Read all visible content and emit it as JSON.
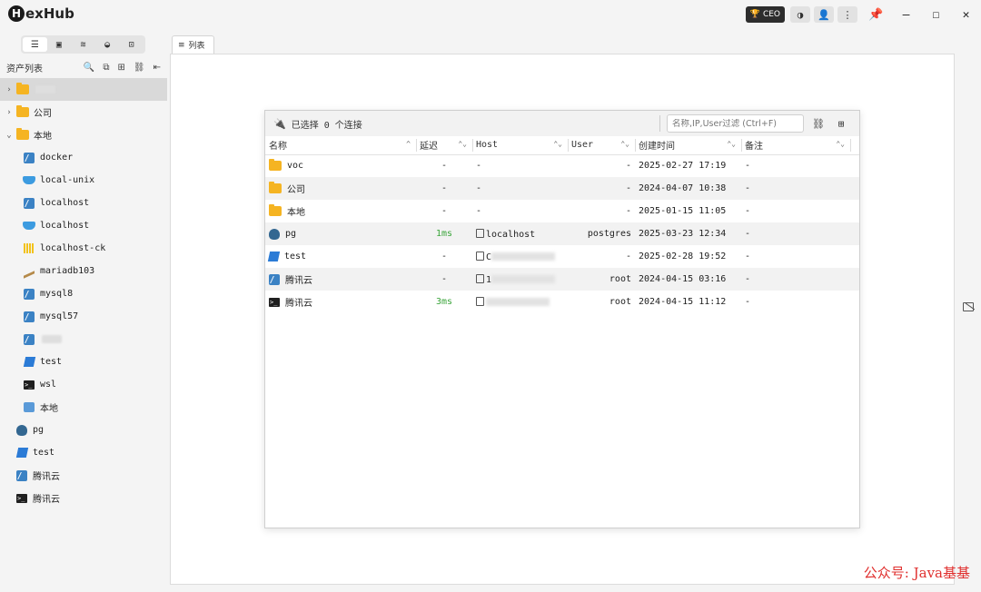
{
  "app": {
    "name": "exHub",
    "logo_letter": "H"
  },
  "titlebar": {
    "ceo_label": "CEO"
  },
  "sidebar": {
    "heading": "资产列表",
    "tree": [
      {
        "label": "",
        "icon": "folder",
        "expanded": false,
        "level": 0,
        "selected": true,
        "blurred": true
      },
      {
        "label": "公司",
        "icon": "folder",
        "expanded": false,
        "level": 0
      },
      {
        "label": "本地",
        "icon": "folder",
        "expanded": true,
        "level": 0
      },
      {
        "label": "docker",
        "icon": "mysql",
        "level": 1
      },
      {
        "label": "local-unix",
        "icon": "docker",
        "level": 1
      },
      {
        "label": "localhost",
        "icon": "mysql",
        "level": 1
      },
      {
        "label": "localhost",
        "icon": "docker",
        "level": 1
      },
      {
        "label": "localhost-ck",
        "icon": "clickhouse",
        "level": 1
      },
      {
        "label": "mariadb103",
        "icon": "mariadb",
        "level": 1
      },
      {
        "label": "mysql8",
        "icon": "mysql",
        "level": 1
      },
      {
        "label": "mysql57",
        "icon": "mysql",
        "level": 1
      },
      {
        "label": "",
        "icon": "mysql",
        "level": 1,
        "blurred": true
      },
      {
        "label": "test",
        "icon": "note",
        "level": 1
      },
      {
        "label": "wsl",
        "icon": "terminal",
        "level": 1
      },
      {
        "label": "本地",
        "icon": "local",
        "level": 1
      },
      {
        "label": "pg",
        "icon": "postgres",
        "level": 0,
        "leaf": true
      },
      {
        "label": "test",
        "icon": "note",
        "level": 0,
        "leaf": true
      },
      {
        "label": "腾讯云",
        "icon": "mysql",
        "level": 0,
        "leaf": true
      },
      {
        "label": "腾讯云",
        "icon": "terminal",
        "level": 0,
        "leaf": true
      }
    ]
  },
  "main": {
    "tab_label": "列表",
    "dialog": {
      "selected_prefix": "已选择",
      "selected_count": "0",
      "selected_suffix": "个连接",
      "filter_placeholder": "名称,IP,User过滤 (Ctrl+F)",
      "columns": [
        "名称",
        "延迟",
        "Host",
        "User",
        "创建时间",
        "备注"
      ],
      "rows": [
        {
          "name": "voc",
          "icon": "folder",
          "latency": "-",
          "host": "-",
          "user": "-",
          "created": "2025-02-27 17:19",
          "note": "-"
        },
        {
          "name": "公司",
          "icon": "folder",
          "latency": "-",
          "host": "-",
          "user": "-",
          "created": "2024-04-07 10:38",
          "note": "-"
        },
        {
          "name": "本地",
          "icon": "folder",
          "latency": "-",
          "host": "-",
          "user": "-",
          "created": "2025-01-15 11:05",
          "note": "-"
        },
        {
          "name": "pg",
          "icon": "postgres",
          "latency": "1ms",
          "host": "localhost",
          "user": "postgres",
          "created": "2025-03-23 12:34",
          "note": "-"
        },
        {
          "name": "test",
          "icon": "note",
          "latency": "-",
          "host": "C",
          "user": "-",
          "created": "2025-02-28 19:52",
          "note": "-"
        },
        {
          "name": "腾讯云",
          "icon": "mysql",
          "latency": "-",
          "host": "1",
          "user": "root",
          "created": "2024-04-15 03:16",
          "note": "-"
        },
        {
          "name": "腾讯云",
          "icon": "terminal",
          "latency": "3ms",
          "host": "",
          "user": "root",
          "created": "2024-04-15 11:12",
          "note": "-"
        }
      ]
    }
  },
  "watermark": "公众号: Java基基",
  "colors": {
    "accent_green": "#3ba53b",
    "folder": "#f5b422",
    "watermark": "#e0302f"
  }
}
